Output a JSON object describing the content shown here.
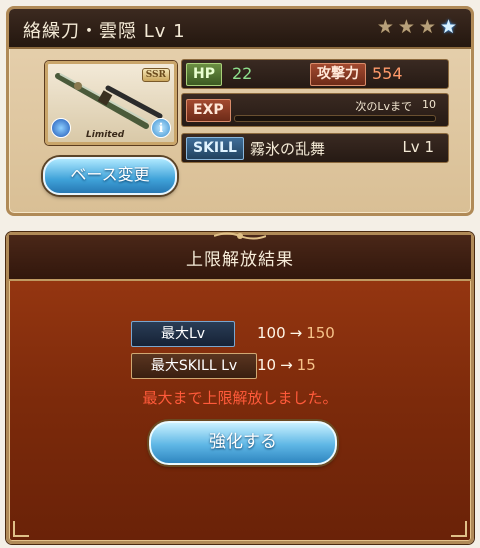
{
  "weapon": {
    "title": "絡繰刀・雲隠 Lv 1",
    "stars_total": 4,
    "stars_lit": 1,
    "rarity": "SSR",
    "limited": "Limited",
    "info_glyph": "i",
    "element_icon": "water-element-icon"
  },
  "stats": {
    "hp_label": "HP",
    "hp_value": "22",
    "atk_label": "攻撃力",
    "atk_value": "554",
    "exp_label": "EXP",
    "exp_caption": "次のLvまで",
    "exp_value": "10",
    "exp_progress": 0.0,
    "skill_label": "SKILL",
    "skill_name": "霧氷の乱舞",
    "skill_lv": "Lv 1"
  },
  "buttons": {
    "base_change": "ベース変更",
    "enhance": "強化する"
  },
  "result": {
    "title": "上限解放結果",
    "max_lv_label": "最大Lv",
    "max_lv_old": "100",
    "max_lv_new": "150",
    "max_skill_label": "最大SKILL Lv",
    "max_skill_old": "10",
    "max_skill_new": "15",
    "arrow": "→",
    "message": "最大まで上限解放しました。"
  },
  "colors": {
    "modal_bg": "#8a300e",
    "panel_bg": "#dcc49b",
    "button_blue": "#3fa2d9",
    "message_red": "#ff5a3a"
  }
}
